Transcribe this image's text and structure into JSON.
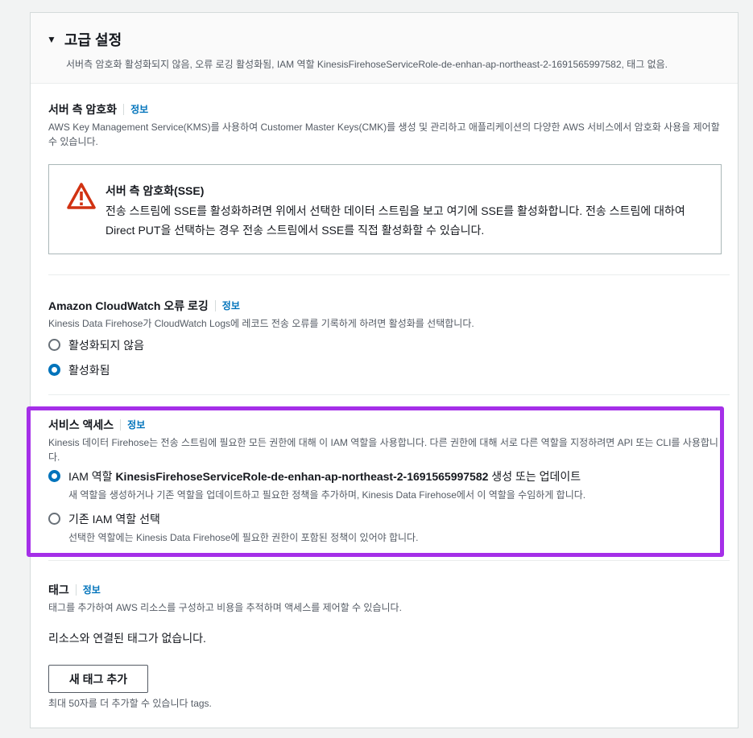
{
  "header": {
    "title": "고급 설정",
    "description": "서버측 암호화 활성화되지 않음, 오류 로깅 활성화됨, IAM 역할 KinesisFirehoseServiceRole-de-enhan-ap-northeast-2-1691565997582, 태그 없음."
  },
  "info_label": "정보",
  "sse": {
    "title": "서버 측 암호화",
    "description": "AWS Key Management Service(KMS)를 사용하여 Customer Master Keys(CMK)를 생성 및 관리하고 애플리케이션의 다양한 AWS 서비스에서 암호화 사용을 제어할 수 있습니다.",
    "alert_title": "서버 측 암호화(SSE)",
    "alert_body": "전송 스트림에 SSE를 활성화하려면 위에서 선택한 데이터 스트림을 보고 여기에 SSE를 활성화합니다. 전송 스트림에 대하여 Direct PUT을 선택하는 경우 전송 스트림에서 SSE를 직접 활성화할 수 있습니다."
  },
  "cloudwatch": {
    "title": "Amazon CloudWatch 오류 로깅",
    "description": "Kinesis Data Firehose가 CloudWatch Logs에 레코드 전송 오류를 기록하게 하려면 활성화를 선택합니다.",
    "option_disabled": "활성화되지 않음",
    "option_enabled": "활성화됨",
    "selected": "enabled"
  },
  "service_access": {
    "title": "서비스 액세스",
    "description": "Kinesis 데이터 Firehose는 전송 스트림에 필요한 모든 권한에 대해 이 IAM 역할을 사용합니다. 다른 권한에 대해 서로 다른 역할을 지정하려면 API 또는 CLI를 사용합니다.",
    "option1_prefix": "IAM 역할 ",
    "option1_role": "KinesisFirehoseServiceRole-de-enhan-ap-northeast-2-1691565997582",
    "option1_suffix": " 생성 또는 업데이트",
    "option1_desc": "새 역할을 생성하거나 기존 역할을 업데이트하고 필요한 정책을 추가하며, Kinesis Data Firehose에서 이 역할을 수임하게 합니다.",
    "option2_label": "기존 IAM 역할 선택",
    "option2_desc": "선택한 역할에는 Kinesis Data Firehose에 필요한 권한이 포함된 정책이 있어야 합니다.",
    "selected": "create",
    "highlight_color": "#a52fe8"
  },
  "tags": {
    "title": "태그",
    "description": "태그를 추가하여 AWS 리소스를 구성하고 비용을 추적하며 액세스를 제어할 수 있습니다.",
    "empty_text": "리소스와 연결된 태그가 없습니다.",
    "add_button": "새 태그 추가",
    "limit_text": "최대 50자를 더 추가할 수 있습니다 tags."
  },
  "colors": {
    "link": "#0073bb",
    "radio_checked": "#0073bb",
    "warning": "#d13212"
  }
}
